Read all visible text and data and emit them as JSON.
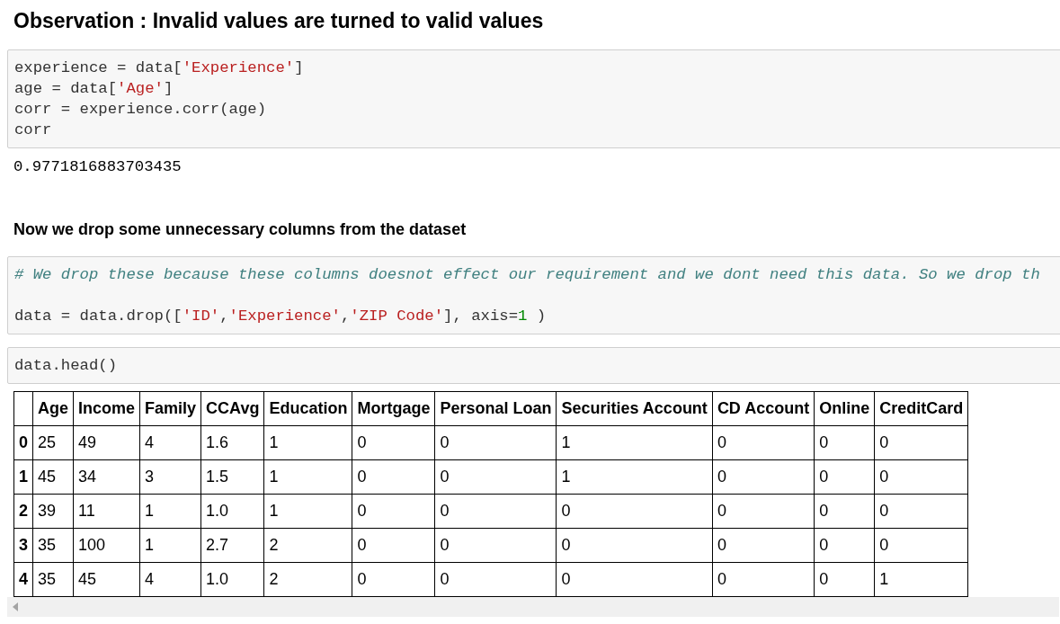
{
  "heading": "Observation : Invalid values are turned to valid values",
  "cells": [
    {
      "kind": "code",
      "lines": [
        {
          "kind": "code",
          "text": "experience = data['Experience']"
        },
        {
          "kind": "code",
          "text": "age = data['Age']"
        },
        {
          "kind": "code",
          "text": "corr = experience.corr(age)"
        },
        {
          "kind": "code",
          "text": "corr"
        }
      ],
      "output": "0.9771816883703435"
    },
    {
      "kind": "markdown",
      "text": "Now we drop some unnecessary columns from the dataset"
    },
    {
      "kind": "code",
      "lines": [
        {
          "kind": "comment",
          "text": "# We drop these because these columns doesnot effect our requirement and we dont need this data. So we drop th"
        },
        {
          "kind": "code",
          "text": "data = data.drop(['ID','Experience','ZIP Code'], axis=1 )"
        }
      ]
    },
    {
      "kind": "code",
      "lines": [
        {
          "kind": "code",
          "text": "data.head()"
        }
      ]
    },
    {
      "kind": "table",
      "columns": [
        "",
        "Age",
        "Income",
        "Family",
        "CCAvg",
        "Education",
        "Mortgage",
        "Personal Loan",
        "Securities Account",
        "CD Account",
        "Online",
        "CreditCard"
      ],
      "rows": [
        [
          "0",
          "25",
          "49",
          "4",
          "1.6",
          "1",
          "0",
          "0",
          "1",
          "0",
          "0",
          "0"
        ],
        [
          "1",
          "45",
          "34",
          "3",
          "1.5",
          "1",
          "0",
          "0",
          "1",
          "0",
          "0",
          "0"
        ],
        [
          "2",
          "39",
          "11",
          "1",
          "1.0",
          "1",
          "0",
          "0",
          "0",
          "0",
          "0",
          "0"
        ],
        [
          "3",
          "35",
          "100",
          "1",
          "2.7",
          "2",
          "0",
          "0",
          "0",
          "0",
          "0",
          "0"
        ],
        [
          "4",
          "35",
          "45",
          "4",
          "1.0",
          "2",
          "0",
          "0",
          "0",
          "0",
          "0",
          "1"
        ]
      ]
    }
  ]
}
